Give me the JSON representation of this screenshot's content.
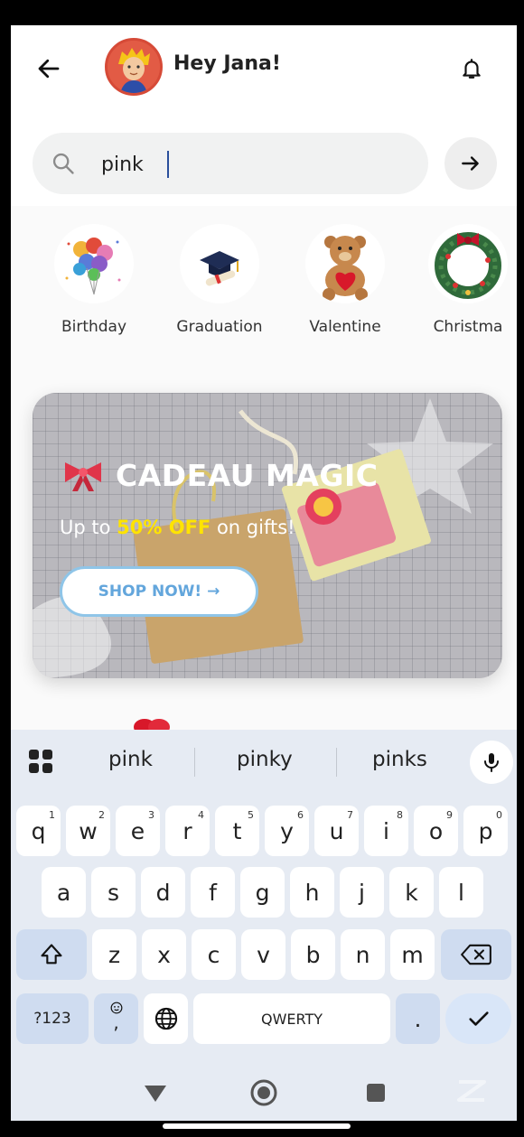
{
  "header": {
    "greeting": "Hey Jana!"
  },
  "search": {
    "value": "pink",
    "placeholder": ""
  },
  "categories": [
    {
      "label": "Birthday"
    },
    {
      "label": "Graduation"
    },
    {
      "label": "Valentine"
    },
    {
      "label": "Christma"
    }
  ],
  "banner": {
    "title": "CADEAU MAGIC",
    "subtitle_pre": "Up to ",
    "subtitle_highlight": "50% OFF",
    "subtitle_post": " on gifts!",
    "cta": "SHOP NOW! →"
  },
  "keyboard": {
    "suggestions": [
      "pink",
      "pinky",
      "pinks"
    ],
    "row1": [
      {
        "k": "q",
        "s": "1"
      },
      {
        "k": "w",
        "s": "2"
      },
      {
        "k": "e",
        "s": "3"
      },
      {
        "k": "r",
        "s": "4"
      },
      {
        "k": "t",
        "s": "5"
      },
      {
        "k": "y",
        "s": "6"
      },
      {
        "k": "u",
        "s": "7"
      },
      {
        "k": "i",
        "s": "8"
      },
      {
        "k": "o",
        "s": "9"
      },
      {
        "k": "p",
        "s": "0"
      }
    ],
    "row2": [
      "a",
      "s",
      "d",
      "f",
      "g",
      "h",
      "j",
      "k",
      "l"
    ],
    "row3": [
      "z",
      "x",
      "c",
      "v",
      "b",
      "n",
      "m"
    ],
    "symbols_label": "?123",
    "comma_label": ",",
    "space_label": "QWERTY",
    "period_label": "."
  },
  "colors": {
    "accent": "#63a6dc",
    "highlight": "#ffe400",
    "keyboard_bg": "#e6ebf3"
  }
}
